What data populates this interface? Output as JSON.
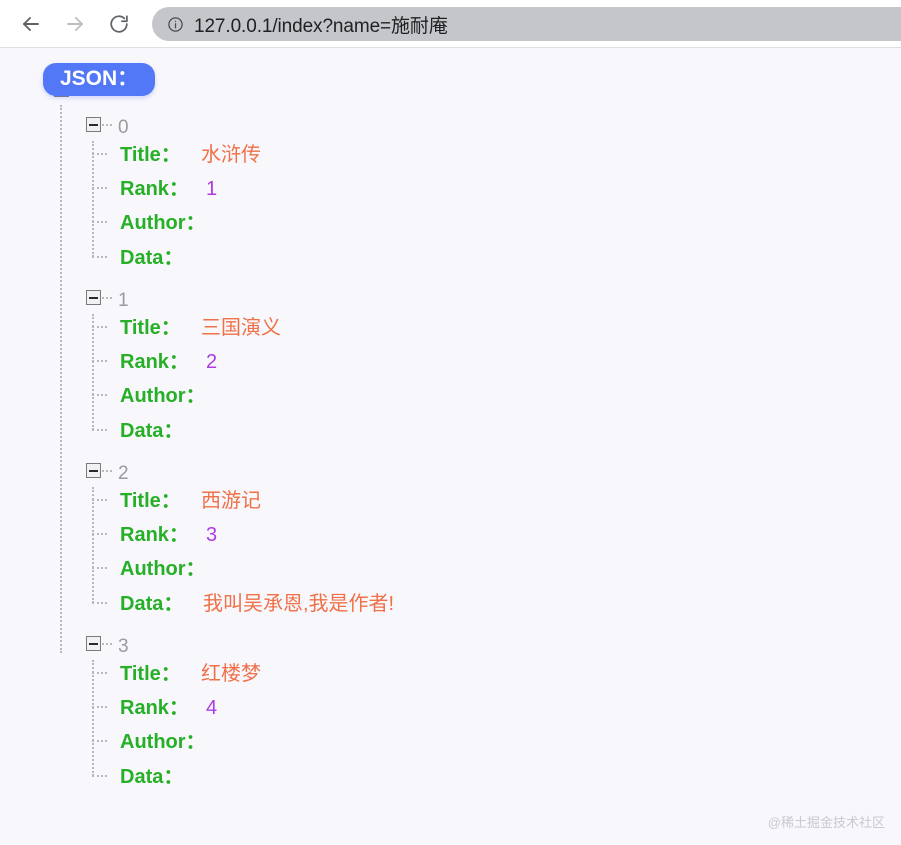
{
  "browser": {
    "back_icon": "arrow-left-icon",
    "forward_icon": "arrow-right-icon",
    "reload_icon": "reload-icon",
    "info_icon": "info-circle-icon",
    "url": "127.0.0.1/index?name=施耐庵",
    "url_placeholder": "Search Google or type a URL"
  },
  "colors": {
    "page_bg": "#f8f7fc",
    "toolbar_bg": "#ffffff",
    "omnibox_bg": "#c5c6c9",
    "badge_bg": "#5277f7",
    "key_green": "#27b027",
    "string_orange": "#f07048",
    "number_purple": "#ab3ce0",
    "index_gray": "#9b9b9e",
    "rail_gray": "#b9b9bb"
  },
  "viewer": {
    "root_label": "JSON：",
    "toggle_icon": "minus-square-toggle-icon",
    "watermark": "@稀土掘金技术社区"
  },
  "json_tree": {
    "items": [
      {
        "index": "0",
        "fields": [
          {
            "key": "Title：",
            "value": "水浒传",
            "type": "string"
          },
          {
            "key": "Rank：",
            "value": "1",
            "type": "number"
          },
          {
            "key": "Author：",
            "value": "",
            "type": "empty"
          },
          {
            "key": "Data：",
            "value": "",
            "type": "empty"
          }
        ]
      },
      {
        "index": "1",
        "fields": [
          {
            "key": "Title：",
            "value": "三国演义",
            "type": "string"
          },
          {
            "key": "Rank：",
            "value": "2",
            "type": "number"
          },
          {
            "key": "Author：",
            "value": "",
            "type": "empty"
          },
          {
            "key": "Data：",
            "value": "",
            "type": "empty"
          }
        ]
      },
      {
        "index": "2",
        "fields": [
          {
            "key": "Title：",
            "value": "西游记",
            "type": "string"
          },
          {
            "key": "Rank：",
            "value": "3",
            "type": "number"
          },
          {
            "key": "Author：",
            "value": "",
            "type": "empty"
          },
          {
            "key": "Data：",
            "value": "我叫吴承恩,我是作者!",
            "type": "string"
          }
        ]
      },
      {
        "index": "3",
        "fields": [
          {
            "key": "Title：",
            "value": "红楼梦",
            "type": "string"
          },
          {
            "key": "Rank：",
            "value": "4",
            "type": "number"
          },
          {
            "key": "Author：",
            "value": "",
            "type": "empty"
          },
          {
            "key": "Data：",
            "value": "",
            "type": "empty"
          }
        ]
      }
    ]
  }
}
